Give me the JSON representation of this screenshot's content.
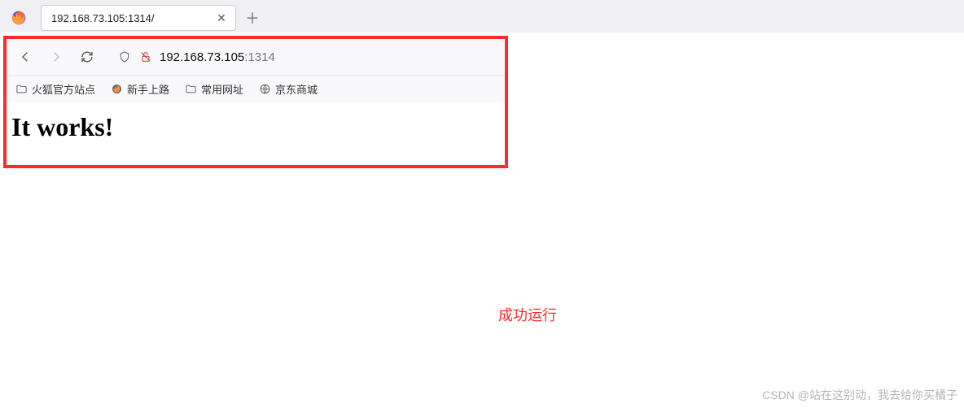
{
  "titlebar": {
    "tab_title": "192.168.73.105:1314/",
    "close_title": "Close tab",
    "new_tab_title": "New tab"
  },
  "navbar": {
    "back_title": "Back",
    "forward_title": "Forward",
    "reload_title": "Reload",
    "shield_title": "Security",
    "lock_title": "Not secure",
    "url_host": "192.168.73.105",
    "url_port": ":1314"
  },
  "bookmarks": [
    {
      "label": "火狐官方站点",
      "icon": "folder"
    },
    {
      "label": "新手上路",
      "icon": "firefox"
    },
    {
      "label": "常用网址",
      "icon": "folder"
    },
    {
      "label": "京东商城",
      "icon": "globe"
    }
  ],
  "page": {
    "heading": "It works!"
  },
  "annotation": {
    "caption": "成功运行"
  },
  "watermark": "CSDN @站在这别动，我去给你买橘子"
}
